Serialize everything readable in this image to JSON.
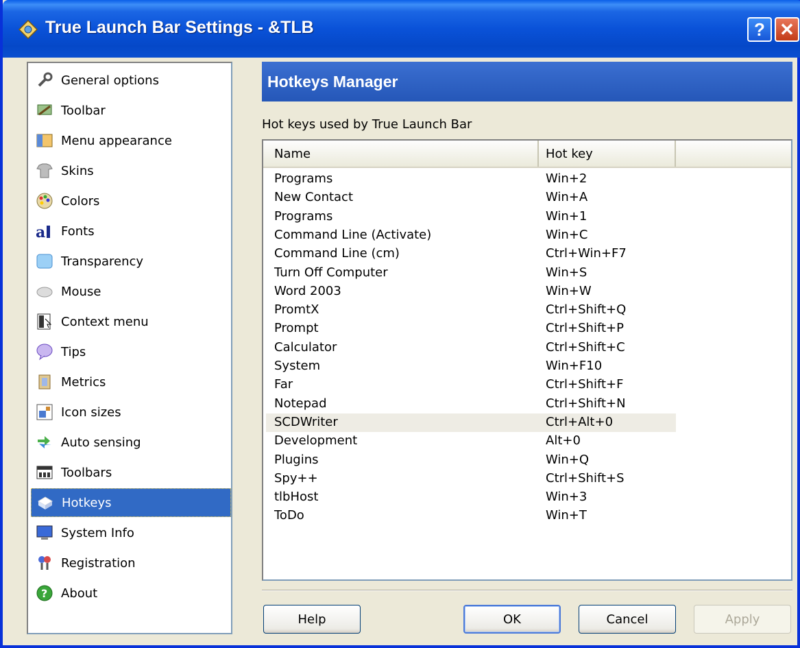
{
  "window": {
    "title": "True Launch Bar Settings - &TLB",
    "help_glyph": "?",
    "close_glyph": "✕"
  },
  "sidebar": {
    "items": [
      {
        "label": "General options",
        "icon": "wrench-icon"
      },
      {
        "label": "Toolbar",
        "icon": "toolbar-tools-icon"
      },
      {
        "label": "Menu appearance",
        "icon": "menu-appearance-icon"
      },
      {
        "label": "Skins",
        "icon": "tshirt-icon"
      },
      {
        "label": "Colors",
        "icon": "palette-icon"
      },
      {
        "label": "Fonts",
        "icon": "fonts-icon"
      },
      {
        "label": "Transparency",
        "icon": "transparency-icon"
      },
      {
        "label": "Mouse",
        "icon": "mouse-icon"
      },
      {
        "label": "Context menu",
        "icon": "context-menu-icon"
      },
      {
        "label": "Tips",
        "icon": "speech-bubble-icon"
      },
      {
        "label": "Metrics",
        "icon": "metrics-icon"
      },
      {
        "label": "Icon sizes",
        "icon": "icon-sizes-icon"
      },
      {
        "label": "Auto sensing",
        "icon": "arrows-icon"
      },
      {
        "label": "Toolbars",
        "icon": "toolbars-icon"
      },
      {
        "label": "Hotkeys",
        "icon": "hotkeys-icon"
      },
      {
        "label": "System Info",
        "icon": "monitor-icon"
      },
      {
        "label": "Registration",
        "icon": "keys-icon"
      },
      {
        "label": "About",
        "icon": "question-icon"
      }
    ],
    "selected": "Hotkeys"
  },
  "main": {
    "header": "Hotkeys Manager",
    "caption": "Hot keys used by True Launch Bar",
    "columns": [
      "Name",
      "Hot key"
    ],
    "rows": [
      {
        "name": "Programs",
        "key": "Win+2"
      },
      {
        "name": "New Contact",
        "key": "Win+A"
      },
      {
        "name": "Programs",
        "key": "Win+1"
      },
      {
        "name": "Command Line (Activate)",
        "key": "Win+C"
      },
      {
        "name": "Command Line (cm)",
        "key": "Ctrl+Win+F7"
      },
      {
        "name": "Turn Off Computer",
        "key": "Win+S"
      },
      {
        "name": "Word 2003",
        "key": "Win+W"
      },
      {
        "name": "PromtX",
        "key": "Ctrl+Shift+Q"
      },
      {
        "name": "Prompt",
        "key": "Ctrl+Shift+P"
      },
      {
        "name": "Calculator",
        "key": "Ctrl+Shift+C"
      },
      {
        "name": "System",
        "key": "Win+F10"
      },
      {
        "name": "Far",
        "key": "Ctrl+Shift+F"
      },
      {
        "name": "Notepad",
        "key": "Ctrl+Shift+N"
      },
      {
        "name": "SCDWriter",
        "key": "Ctrl+Alt+0"
      },
      {
        "name": "Development",
        "key": "Alt+0"
      },
      {
        "name": "Plugins",
        "key": "Win+Q"
      },
      {
        "name": "Spy++",
        "key": "Ctrl+Shift+S"
      },
      {
        "name": "tlbHost",
        "key": "Win+3"
      },
      {
        "name": "ToDo",
        "key": "Win+T"
      }
    ],
    "highlighted_row": "SCDWriter"
  },
  "buttons": {
    "help": "Help",
    "ok": "OK",
    "cancel": "Cancel",
    "apply": "Apply"
  }
}
